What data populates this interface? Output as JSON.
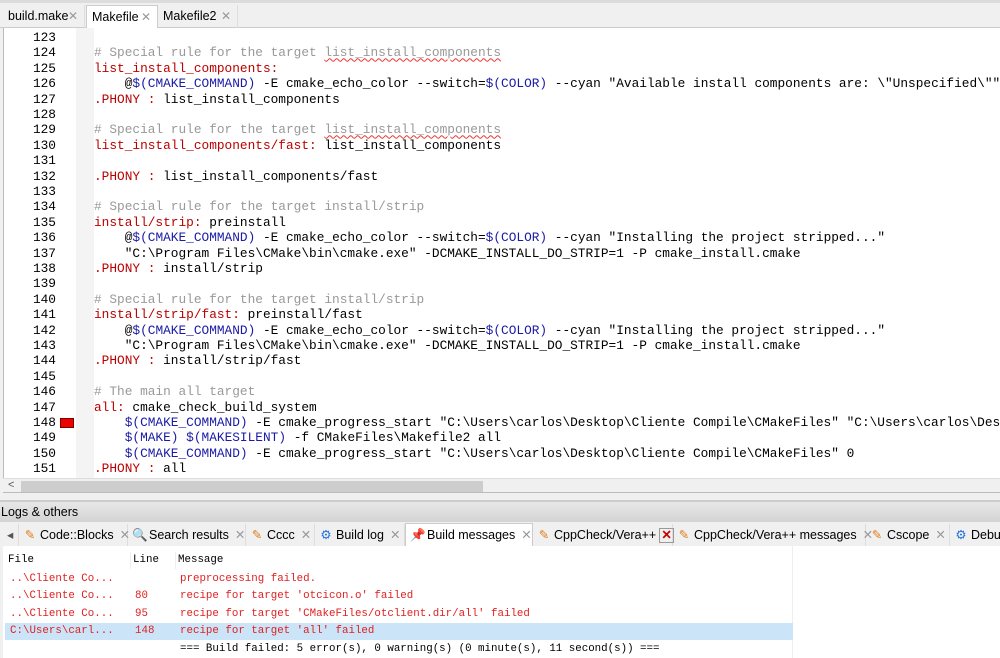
{
  "editor_tabs": [
    {
      "label": "build.make",
      "active": false
    },
    {
      "label": "Makefile",
      "active": true
    },
    {
      "label": "Makefile2",
      "active": false
    }
  ],
  "code_lines": [
    {
      "n": "123",
      "segs": []
    },
    {
      "n": "124",
      "segs": [
        {
          "c": "cm",
          "t": "# Special rule for the target "
        },
        {
          "c": "cm sq",
          "t": "list_install_components"
        }
      ]
    },
    {
      "n": "125",
      "segs": [
        {
          "c": "tg",
          "t": "list_install_components:"
        }
      ]
    },
    {
      "n": "126",
      "segs": [
        {
          "c": "tx",
          "t": "    @"
        },
        {
          "c": "vr",
          "t": "$(CMAKE_COMMAND)"
        },
        {
          "c": "tx",
          "t": " -E cmake_echo_color --switch="
        },
        {
          "c": "vr",
          "t": "$(COLOR)"
        },
        {
          "c": "tx",
          "t": " --cyan \"Available install components are: \\\"Unspecified\\\"\""
        }
      ]
    },
    {
      "n": "127",
      "segs": [
        {
          "c": "tg",
          "t": ".PHONY :"
        },
        {
          "c": "tx",
          "t": " list_install_components"
        }
      ]
    },
    {
      "n": "128",
      "segs": []
    },
    {
      "n": "129",
      "segs": [
        {
          "c": "cm",
          "t": "# Special rule for the target "
        },
        {
          "c": "cm sq",
          "t": "list_install_components"
        }
      ]
    },
    {
      "n": "130",
      "segs": [
        {
          "c": "tg",
          "t": "list_install_components/fast:"
        },
        {
          "c": "tx",
          "t": " list_install_components"
        }
      ]
    },
    {
      "n": "131",
      "segs": []
    },
    {
      "n": "132",
      "segs": [
        {
          "c": "tg",
          "t": ".PHONY :"
        },
        {
          "c": "tx",
          "t": " list_install_components/fast"
        }
      ]
    },
    {
      "n": "133",
      "segs": []
    },
    {
      "n": "134",
      "segs": [
        {
          "c": "cm",
          "t": "# Special rule for the target install/strip"
        }
      ]
    },
    {
      "n": "135",
      "segs": [
        {
          "c": "tg",
          "t": "install/strip:"
        },
        {
          "c": "tx",
          "t": " preinstall"
        }
      ]
    },
    {
      "n": "136",
      "segs": [
        {
          "c": "tx",
          "t": "    @"
        },
        {
          "c": "vr",
          "t": "$(CMAKE_COMMAND)"
        },
        {
          "c": "tx",
          "t": " -E cmake_echo_color --switch="
        },
        {
          "c": "vr",
          "t": "$(COLOR)"
        },
        {
          "c": "tx",
          "t": " --cyan \"Installing the project stripped...\""
        }
      ]
    },
    {
      "n": "137",
      "segs": [
        {
          "c": "tx",
          "t": "    \"C:\\Program Files\\CMake\\bin\\cmake.exe\" -DCMAKE_INSTALL_DO_STRIP=1 -P cmake_install.cmake"
        }
      ]
    },
    {
      "n": "138",
      "segs": [
        {
          "c": "tg",
          "t": ".PHONY :"
        },
        {
          "c": "tx",
          "t": " install/strip"
        }
      ]
    },
    {
      "n": "139",
      "segs": []
    },
    {
      "n": "140",
      "segs": [
        {
          "c": "cm",
          "t": "# Special rule for the target install/strip"
        }
      ]
    },
    {
      "n": "141",
      "segs": [
        {
          "c": "tg",
          "t": "install/strip/fast:"
        },
        {
          "c": "tx",
          "t": " preinstall/fast"
        }
      ]
    },
    {
      "n": "142",
      "segs": [
        {
          "c": "tx",
          "t": "    @"
        },
        {
          "c": "vr",
          "t": "$(CMAKE_COMMAND)"
        },
        {
          "c": "tx",
          "t": " -E cmake_echo_color --switch="
        },
        {
          "c": "vr",
          "t": "$(COLOR)"
        },
        {
          "c": "tx",
          "t": " --cyan \"Installing the project stripped...\""
        }
      ]
    },
    {
      "n": "143",
      "segs": [
        {
          "c": "tx",
          "t": "    \"C:\\Program Files\\CMake\\bin\\cmake.exe\" -DCMAKE_INSTALL_DO_STRIP=1 -P cmake_install.cmake"
        }
      ]
    },
    {
      "n": "144",
      "segs": [
        {
          "c": "tg",
          "t": ".PHONY :"
        },
        {
          "c": "tx",
          "t": " install/strip/fast"
        }
      ]
    },
    {
      "n": "145",
      "segs": []
    },
    {
      "n": "146",
      "segs": [
        {
          "c": "cm",
          "t": "# The main all target"
        }
      ]
    },
    {
      "n": "147",
      "segs": [
        {
          "c": "tg",
          "t": "all:"
        },
        {
          "c": "tx",
          "t": " cmake_check_build_system"
        }
      ]
    },
    {
      "n": "148",
      "error": true,
      "segs": [
        {
          "c": "tx",
          "t": "    "
        },
        {
          "c": "vr",
          "t": "$(CMAKE_COMMAND)"
        },
        {
          "c": "tx",
          "t": " -E cmake_progress_start \"C:\\Users\\carlos\\Desktop\\Cliente Compile\\CMakeFiles\" \"C:\\Users\\carlos\\Desktop"
        }
      ]
    },
    {
      "n": "149",
      "segs": [
        {
          "c": "tx",
          "t": "    "
        },
        {
          "c": "vr",
          "t": "$(MAKE)"
        },
        {
          "c": "tx",
          "t": " "
        },
        {
          "c": "vr",
          "t": "$(MAKESILENT)"
        },
        {
          "c": "tx",
          "t": " -f CMakeFiles\\Makefile2 all"
        }
      ]
    },
    {
      "n": "150",
      "segs": [
        {
          "c": "tx",
          "t": "    "
        },
        {
          "c": "vr",
          "t": "$(CMAKE_COMMAND)"
        },
        {
          "c": "tx",
          "t": " -E cmake_progress_start \"C:\\Users\\carlos\\Desktop\\Cliente Compile\\CMakeFiles\" 0"
        }
      ]
    },
    {
      "n": "151",
      "segs": [
        {
          "c": "tg",
          "t": ".PHONY :"
        },
        {
          "c": "tx",
          "t": " all"
        }
      ]
    }
  ],
  "logs": {
    "title": "Logs & others",
    "tabs": [
      {
        "label": "Code::Blocks",
        "icon": "notepad-icon"
      },
      {
        "label": "Search results",
        "icon": "magnifier-icon"
      },
      {
        "label": "Cccc",
        "icon": "notepad-icon"
      },
      {
        "label": "Build log",
        "icon": "gear-icon"
      },
      {
        "label": "Build messages",
        "icon": "pin-icon",
        "active": true
      },
      {
        "label": "CppCheck/Vera++",
        "icon": "notepad-icon",
        "red_close": true
      },
      {
        "label": "CppCheck/Vera++ messages",
        "icon": "notepad-icon"
      },
      {
        "label": "Cscope",
        "icon": "notepad-icon"
      },
      {
        "label": "Debugger",
        "icon": "gear-icon"
      }
    ],
    "columns": [
      "File",
      "Line",
      "Message"
    ],
    "rows": [
      {
        "file": "..\\Cliente Co...",
        "line": "",
        "message": "preprocessing failed."
      },
      {
        "file": "..\\Cliente Co...",
        "line": "80",
        "message": "recipe for target 'otcicon.o' failed"
      },
      {
        "file": "..\\Cliente Co...",
        "line": "95",
        "message": "recipe for target 'CMakeFiles/otclient.dir/all' failed"
      },
      {
        "file": "C:\\Users\\carl...",
        "line": "148",
        "message": "recipe for target 'all' failed",
        "selected": true
      },
      {
        "file": "",
        "line": "",
        "message": "=== Build failed: 5 error(s), 0 warning(s) (0 minute(s), 11 second(s)) ===",
        "ok": true
      }
    ]
  },
  "colors": {
    "error": "#e02020",
    "selection": "#cce4f7",
    "comment": "#999999",
    "target": "#bb0000",
    "variable": "#1a1aa6"
  }
}
